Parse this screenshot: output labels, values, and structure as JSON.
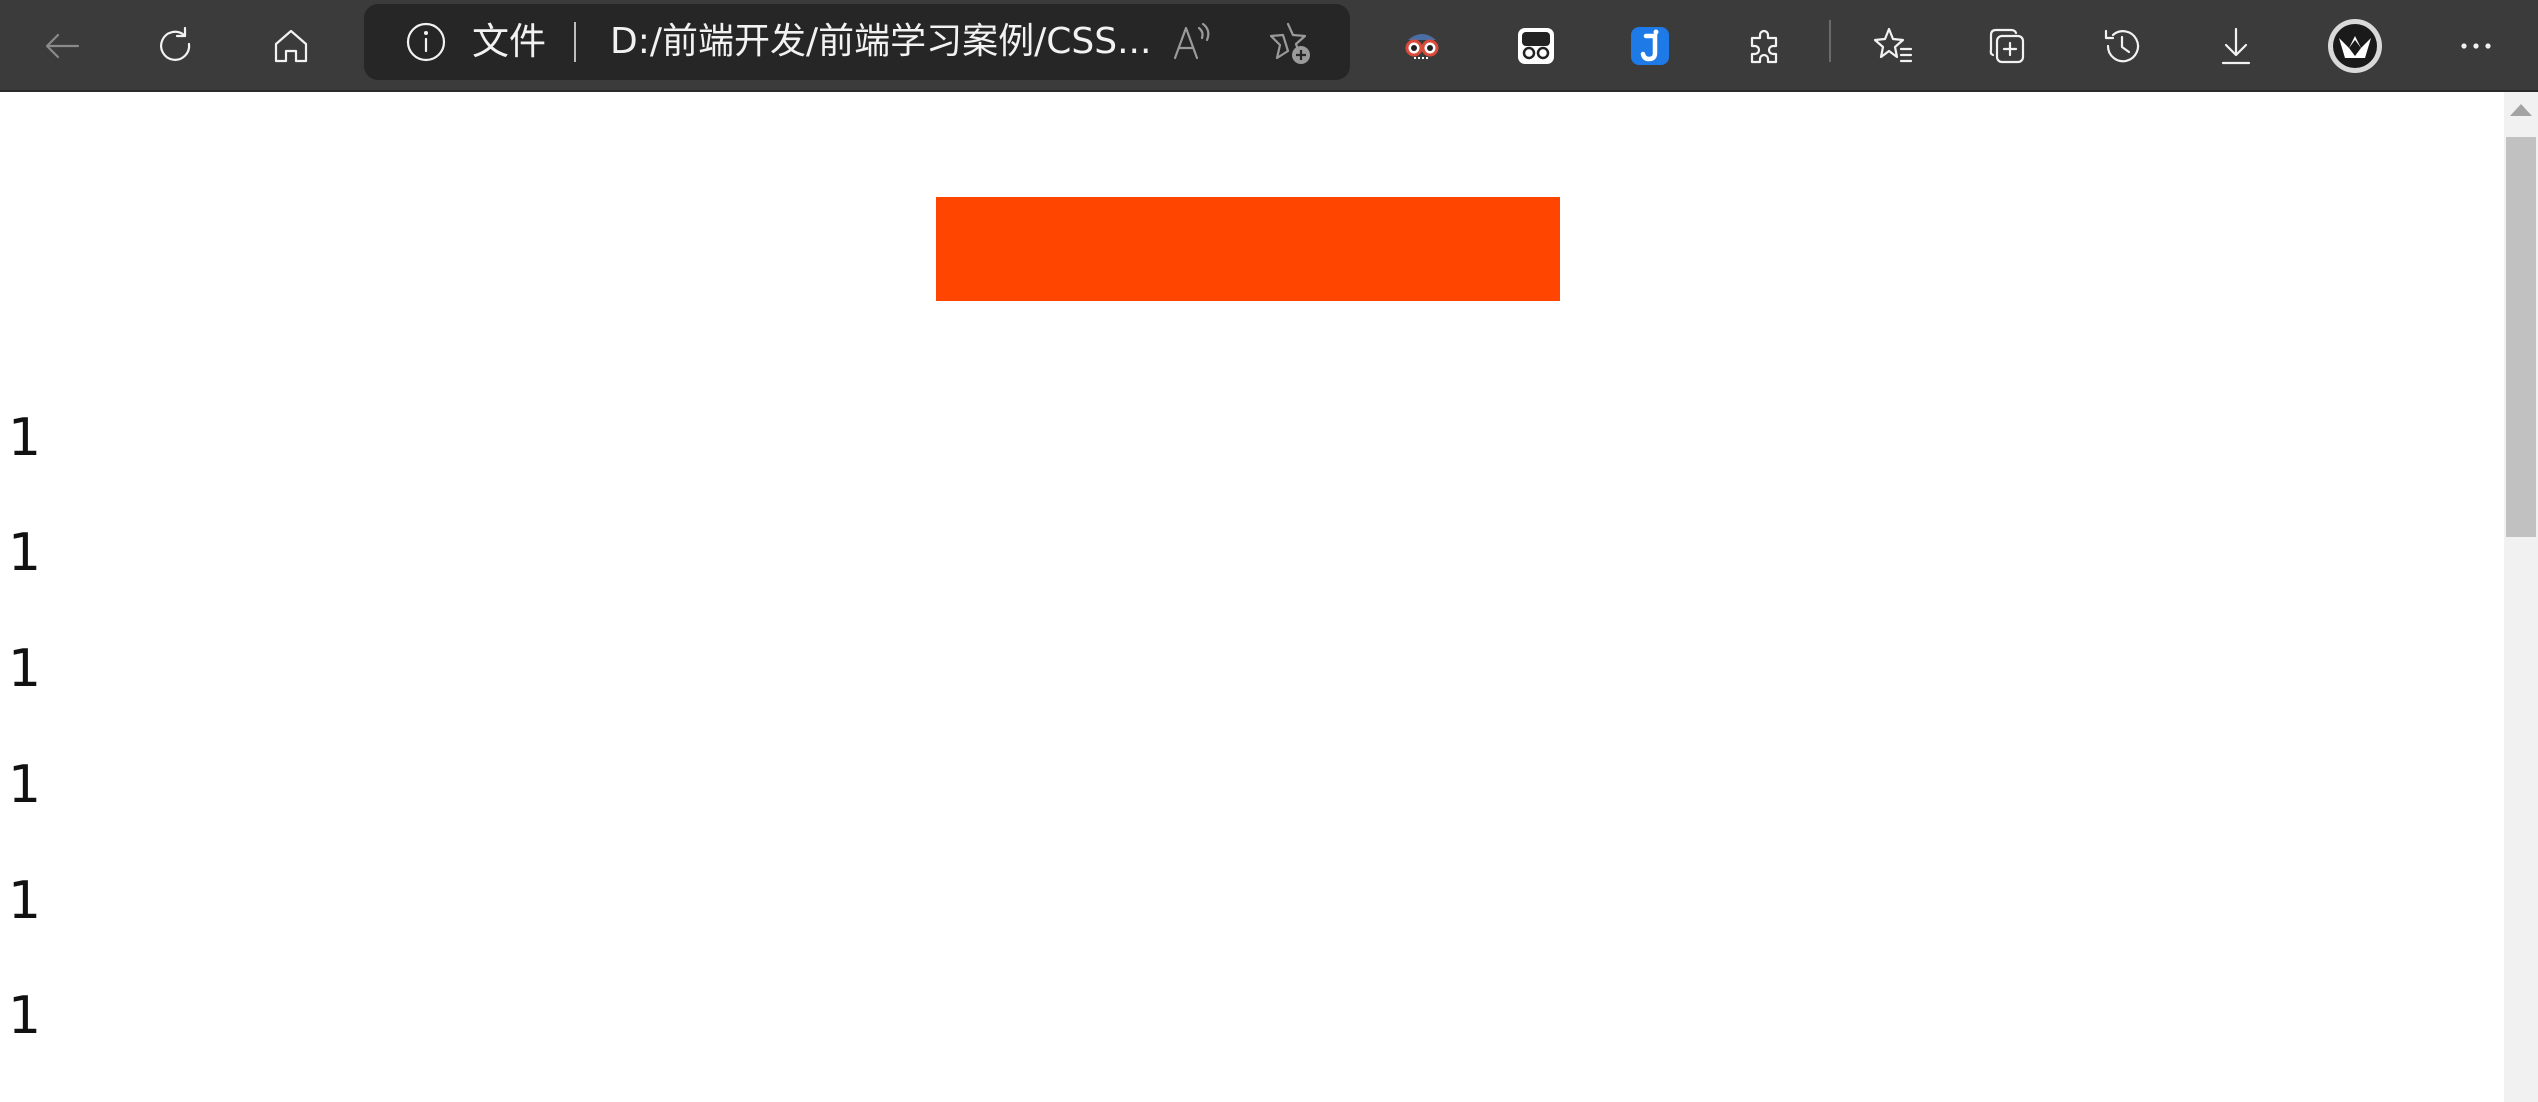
{
  "browser": {
    "address_bar": {
      "security_label": "文件",
      "url": "D:/前端开发/前端学习案例/CSS..."
    },
    "icons": {
      "back": "back-arrow-icon",
      "refresh": "refresh-icon",
      "home": "home-icon",
      "info": "info-icon",
      "read_aloud": "read-aloud-icon",
      "add_favorite": "add-favorite-icon",
      "extension_1": "glasses-extension-icon",
      "extension_2": "mask-extension-icon",
      "extension_3": "j-extension-icon",
      "extensions": "extensions-puzzle-icon",
      "favorites": "favorites-list-icon",
      "collections": "collections-icon",
      "history": "history-icon",
      "downloads": "download-icon",
      "profile": "profile-avatar-icon",
      "more": "more-dots-icon"
    }
  },
  "page": {
    "box_color": "#ff4500",
    "lines": [
      "1",
      "1",
      "1",
      "1",
      "1",
      "1"
    ]
  }
}
